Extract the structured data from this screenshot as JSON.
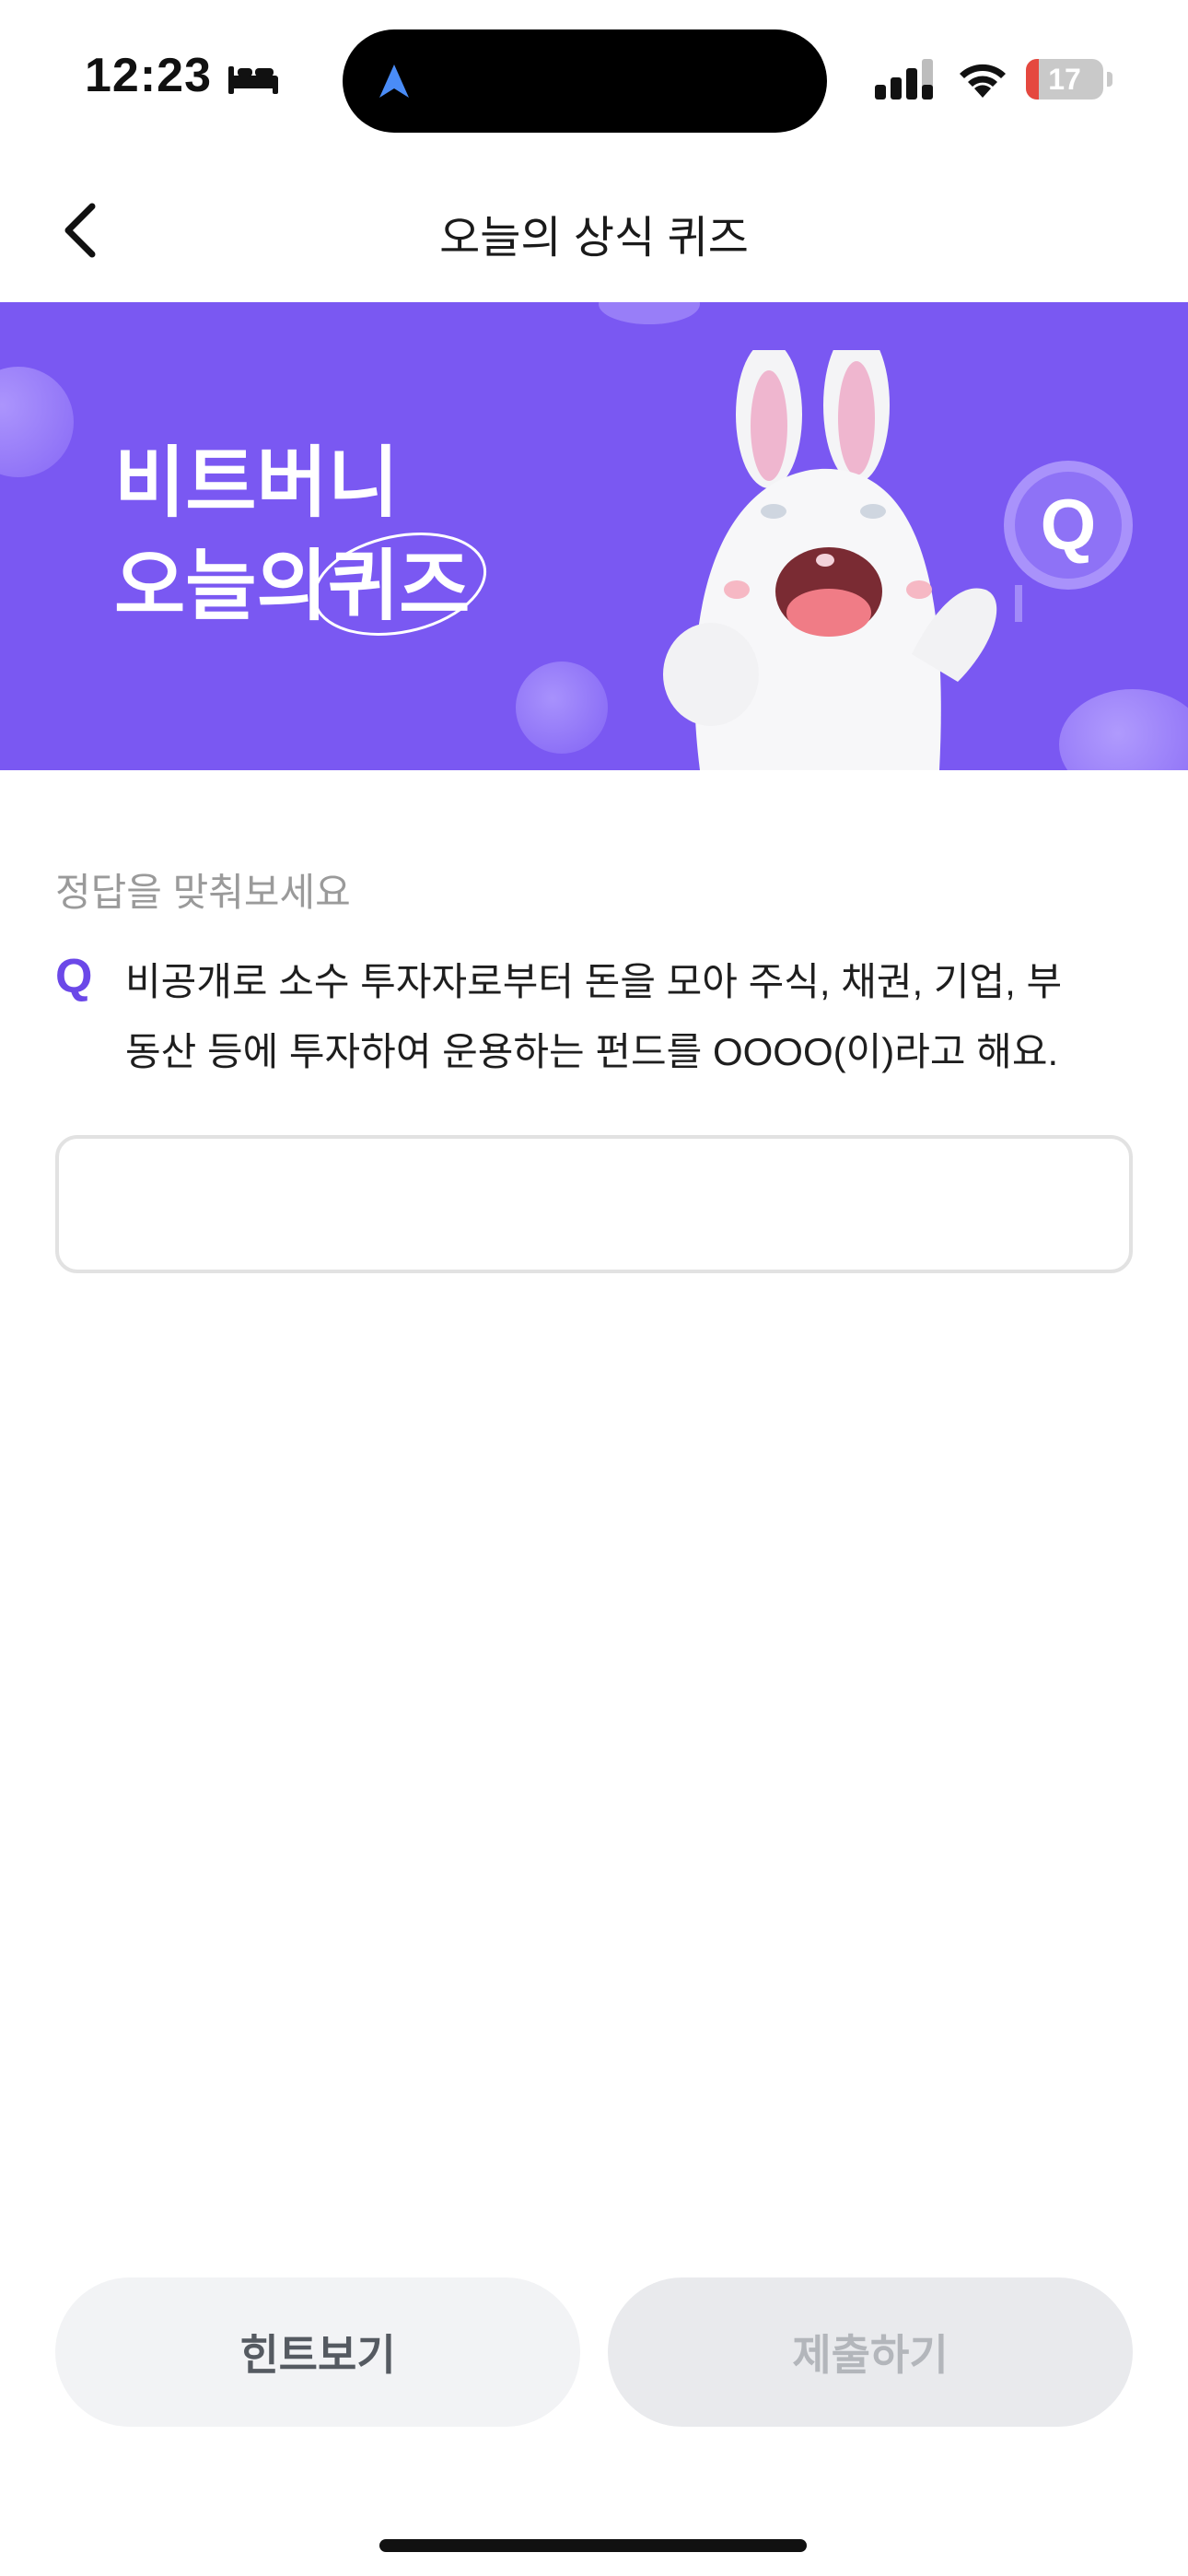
{
  "status_bar": {
    "time": "12:23",
    "battery_level": 17,
    "battery_text": "17",
    "battery_color": "#e5483f",
    "icons": [
      "bed-icon",
      "location-arrow-icon",
      "cellular-signal-icon",
      "wifi-icon",
      "battery-icon"
    ]
  },
  "header": {
    "title": "오늘의 상식 퀴즈",
    "back_icon": "chevron-left-icon"
  },
  "banner": {
    "line1": "비트버니",
    "line2_prefix": "오늘의",
    "line2_highlight": "퀴즈",
    "background_color": "#7a58f2",
    "sign_letter": "Q"
  },
  "quiz": {
    "instruction": "정답을 맞춰보세요",
    "q_label": "Q",
    "question_line1": "비공개로 소수 투자자로부터 돈을 모아 주식, 채권, 기업, 부",
    "question_line2": "동산 등에 투자하여 운용하는 펀드를 OOOO(이)라고 해요.",
    "answer_value": "",
    "answer_placeholder": ""
  },
  "buttons": {
    "hint": "힌트보기",
    "submit": "제출하기"
  },
  "colors": {
    "accent": "#6b48e8",
    "banner": "#7a58f2"
  }
}
